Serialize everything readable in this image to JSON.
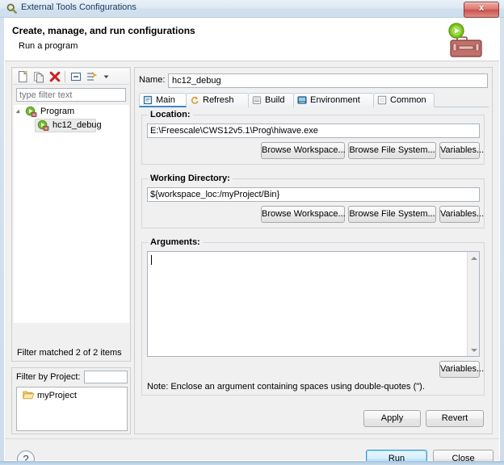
{
  "window": {
    "title": "External Tools Configurations",
    "title_icon": "external-tools-icon",
    "close_label": "x"
  },
  "banner": {
    "title": "Create, manage, and run configurations",
    "subtitle": "Run a program",
    "icon": "toolbox-with-run-badge-icon"
  },
  "left_pane": {
    "toolbar": [
      {
        "name": "new-configuration-icon",
        "tooltip": "New launch configuration"
      },
      {
        "name": "duplicate-configuration-icon",
        "tooltip": "Duplicate"
      },
      {
        "name": "delete-configuration-icon",
        "tooltip": "Delete"
      },
      {
        "name": "collapse-all-icon",
        "tooltip": "Collapse All"
      },
      {
        "name": "filter-icon",
        "tooltip": "Filter"
      },
      {
        "name": "chevron-down-icon",
        "tooltip": "Menu"
      }
    ],
    "filter_placeholder": "type filter text",
    "filter_value": "",
    "tree": [
      {
        "label": "Program",
        "icon": "program-icon",
        "expanded": true,
        "selected": false,
        "depth": 0
      },
      {
        "label": "hc12_debug",
        "icon": "program-icon",
        "expanded": false,
        "selected": true,
        "depth": 1
      }
    ],
    "filter_status": "Filter matched 2 of 2 items",
    "project_filter_label": "Filter by Project:",
    "project_filter_value": "",
    "projects": [
      {
        "label": "myProject",
        "icon": "folder-icon"
      }
    ]
  },
  "right_pane": {
    "name_label": "Name:",
    "name_value": "hc12_debug",
    "tabs": [
      {
        "label": "Main",
        "icon": "main-tab-icon",
        "active": true
      },
      {
        "label": "Refresh",
        "icon": "refresh-tab-icon",
        "active": false
      },
      {
        "label": "Build",
        "icon": "build-tab-icon",
        "active": false
      },
      {
        "label": "Environment",
        "icon": "environment-tab-icon",
        "active": false
      },
      {
        "label": "Common",
        "icon": "common-tab-icon",
        "active": false
      }
    ],
    "location": {
      "group_label": "Location:",
      "value": "E:\\Freescale\\CWS12v5.1\\Prog\\hiwave.exe",
      "buttons": [
        "Browse Workspace...",
        "Browse File System...",
        "Variables..."
      ]
    },
    "working_directory": {
      "group_label": "Working Directory:",
      "value": "${workspace_loc:/myProject/Bin}",
      "buttons": [
        "Browse Workspace...",
        "Browse File System...",
        "Variables..."
      ]
    },
    "arguments": {
      "group_label": "Arguments:",
      "value": "",
      "variables_button": "Variables...",
      "note": "Note: Enclose an argument containing spaces using double-quotes (\")."
    },
    "apply_label": "Apply",
    "revert_label": "Revert"
  },
  "footer": {
    "help_label": "?",
    "run_label": "Run",
    "close_label": "Close"
  },
  "colors": {
    "accent": "#3e86c8",
    "default_button_border": "#3c9cd6",
    "delete_icon": "#cc2222",
    "run_badge": "#5aaa1e",
    "toolbox": "#b35a55",
    "title_text": "#17385e"
  }
}
